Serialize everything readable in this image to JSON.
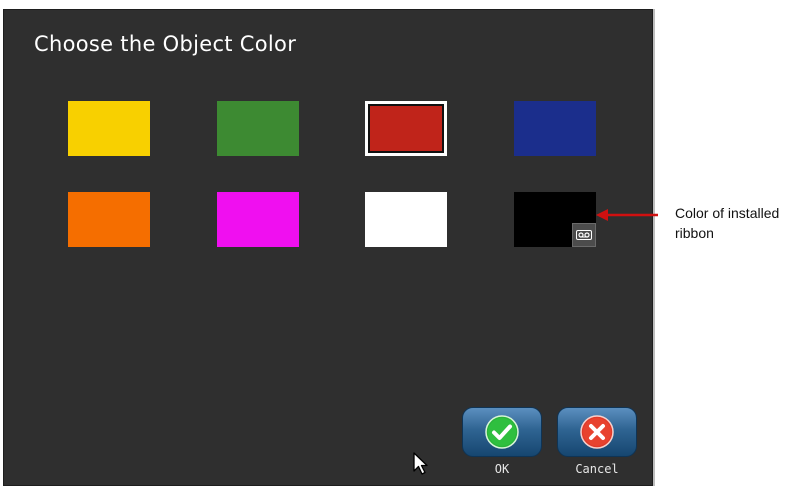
{
  "dialog": {
    "title": "Choose the Object Color"
  },
  "swatches": [
    {
      "name": "yellow",
      "color": "#f8d000",
      "selected": false
    },
    {
      "name": "green",
      "color": "#3d8a32",
      "selected": false
    },
    {
      "name": "red",
      "color": "#c0241a",
      "selected": true
    },
    {
      "name": "blue",
      "color": "#1b2e8c",
      "selected": false
    },
    {
      "name": "orange",
      "color": "#f56e00",
      "selected": false
    },
    {
      "name": "magenta",
      "color": "#f00ff0",
      "selected": false
    },
    {
      "name": "white",
      "color": "#ffffff",
      "selected": false
    },
    {
      "name": "black",
      "color": "#000000",
      "selected": false,
      "badge_icon": "ribbon-cassette-icon"
    }
  ],
  "buttons": {
    "ok_label": "OK",
    "ok_icon": "checkmark-icon",
    "cancel_label": "Cancel",
    "cancel_icon": "x-icon"
  },
  "callout": {
    "text": "Color of installed ribbon",
    "color": "#d01010"
  }
}
